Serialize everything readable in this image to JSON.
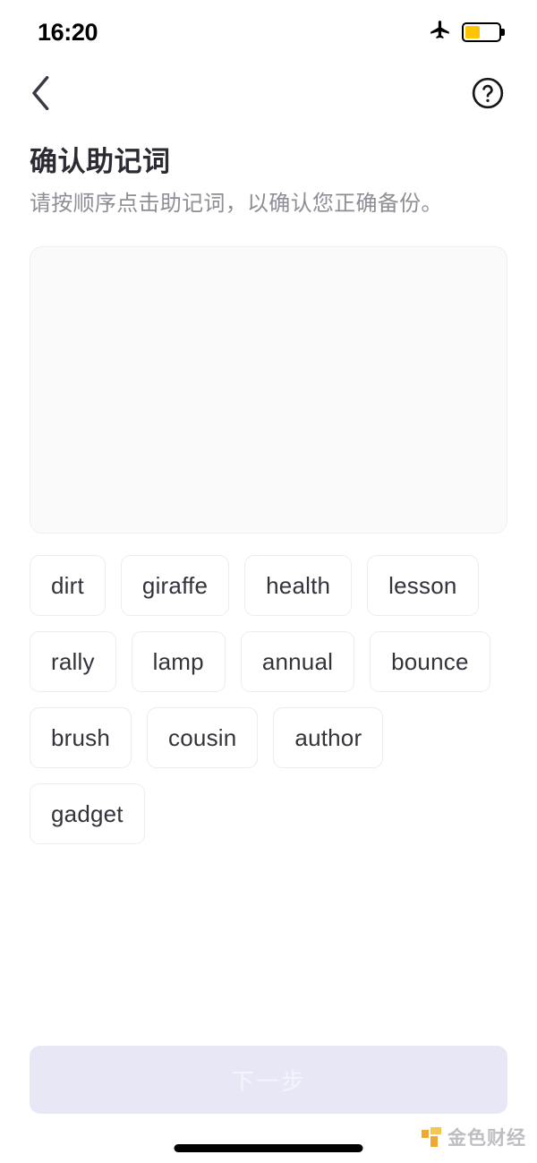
{
  "status_bar": {
    "time": "16:20",
    "airplane_icon": "airplane-mode-icon",
    "battery_icon": "battery-icon",
    "battery_level_percent": 45,
    "battery_color": "#fdc500"
  },
  "nav": {
    "back_icon": "chevron-left-icon",
    "help_icon": "question-circle-icon"
  },
  "heading": {
    "title": "确认助记词",
    "subtitle": "请按顺序点击助记词，以确认您正确备份。"
  },
  "answer_box": {
    "selected_words": []
  },
  "word_pool": {
    "words": [
      "dirt",
      "giraffe",
      "health",
      "lesson",
      "rally",
      "lamp",
      "annual",
      "bounce",
      "brush",
      "cousin",
      "author",
      "gadget"
    ]
  },
  "footer": {
    "next_label": "下一步",
    "next_enabled": false,
    "next_disabled_bg": "#e7e7f6"
  },
  "watermark": {
    "text": "金色财经",
    "logo_icon": "jinse-logo-icon",
    "logo_color": "#f0a023"
  },
  "home_indicator": {
    "name": "home-indicator-bar"
  }
}
